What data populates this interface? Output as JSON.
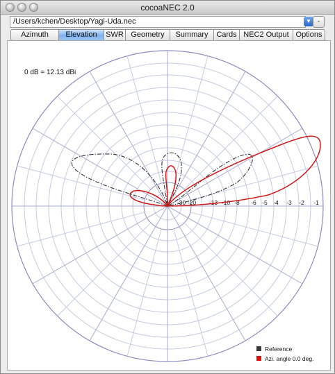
{
  "window": {
    "title": "cocoaNEC 2.0"
  },
  "toolbar": {
    "file_path": "/Users/kchen/Desktop/Yagi-Uda.nec",
    "minus_label": "-"
  },
  "tabs": [
    {
      "label": "Azimuth",
      "active": false
    },
    {
      "label": "Elevation",
      "active": true
    },
    {
      "label": "SWR",
      "active": false
    },
    {
      "label": "Geometry",
      "active": false
    },
    {
      "label": "Summary",
      "active": false
    },
    {
      "label": "Cards",
      "active": false
    },
    {
      "label": "NEC2 Output",
      "active": false
    },
    {
      "label": "Options",
      "active": false
    }
  ],
  "plot": {
    "reference_level": "0 dB = 12.13 dBi",
    "ring_labels": [
      "-30",
      "-20",
      "-13",
      "-10",
      "-8",
      "-6",
      "-5",
      "-4",
      "-3",
      "-2",
      "-1"
    ],
    "legend": [
      {
        "label": "Reference",
        "color": "#3a3a3a"
      },
      {
        "label": "Azi. angle  0.0 deg.",
        "color": "#e0100f"
      }
    ],
    "colors": {
      "grid_rings": "#c9c9e3",
      "grid_spokes": "#a9a9cf",
      "pattern": "#d11818",
      "reference": "#333333"
    }
  }
}
